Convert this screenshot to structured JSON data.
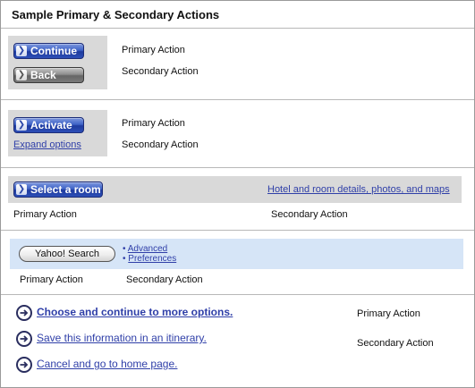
{
  "title": "Sample Primary & Secondary Actions",
  "section1": {
    "primary_button": "Continue",
    "secondary_button": "Back",
    "primary_label": "Primary Action",
    "secondary_label": "Secondary Action"
  },
  "section2": {
    "primary_button": "Activate",
    "secondary_link": "Expand options",
    "primary_label": "Primary Action",
    "secondary_label": "Secondary Action"
  },
  "section3": {
    "primary_button": "Select a room",
    "secondary_link": "Hotel and room details, photos, and maps",
    "primary_label": "Primary Action",
    "secondary_label": "Secondary Action"
  },
  "section4": {
    "search_button": "Yahoo! Search",
    "links": [
      "Advanced",
      "Preferences"
    ],
    "primary_label": "Primary Action",
    "secondary_label": "Secondary Action"
  },
  "section5": {
    "links": [
      "Choose and continue to more options.",
      "Save this information in an itinerary.",
      "Cancel and go to home page."
    ],
    "primary_label": "Primary Action",
    "secondary_label": "Secondary Action"
  },
  "colors": {
    "accent_blue": "#2f3fa8",
    "button_blue": "#3f63c7",
    "panel_gray": "#d9d9d9",
    "search_bar": "#d6e5f7"
  }
}
